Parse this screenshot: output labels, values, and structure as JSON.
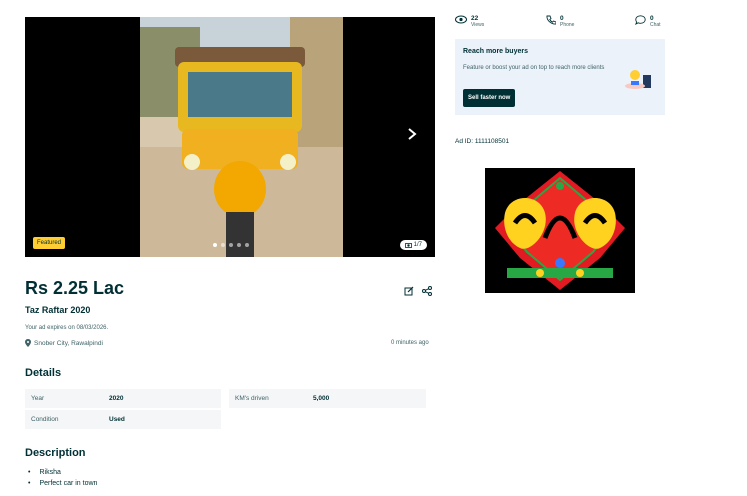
{
  "gallery": {
    "featured_label": "Featured",
    "counter": "1/7",
    "icons": {
      "next": "chevron-right-icon",
      "camera": "camera-icon"
    }
  },
  "listing": {
    "price": "Rs 2.25 Lac",
    "title": "Taz Raftar 2020",
    "expires": "Your ad expires on 08/03/2026.",
    "location": "Snober City, Rawalpindi",
    "posted": "0 minutes ago",
    "icons": {
      "edit": "edit-icon",
      "share": "share-icon",
      "location": "location-pin-icon"
    }
  },
  "details": {
    "heading": "Details",
    "rows": [
      {
        "label": "Year",
        "value": "2020"
      },
      {
        "label": "KM's driven",
        "value": "5,000"
      },
      {
        "label": "Condition",
        "value": "Used"
      }
    ]
  },
  "description": {
    "heading": "Description",
    "items": [
      "Riksha",
      "Perfect car in town"
    ]
  },
  "stats": {
    "views": {
      "count": "22",
      "label": "Views",
      "icon": "eye-icon"
    },
    "phone": {
      "count": "0",
      "label": "Phone",
      "icon": "phone-icon"
    },
    "chat": {
      "count": "0",
      "label": "Chat",
      "icon": "chat-icon"
    }
  },
  "promo": {
    "title": "Reach more buyers",
    "text": "Feature or boost your ad on top to reach more clients",
    "button": "Sell faster now"
  },
  "ad_id": "Ad ID: 1111108501",
  "colors": {
    "primary": "#002f34",
    "featured": "#ffce32",
    "promo_bg": "#ebf2fa"
  }
}
